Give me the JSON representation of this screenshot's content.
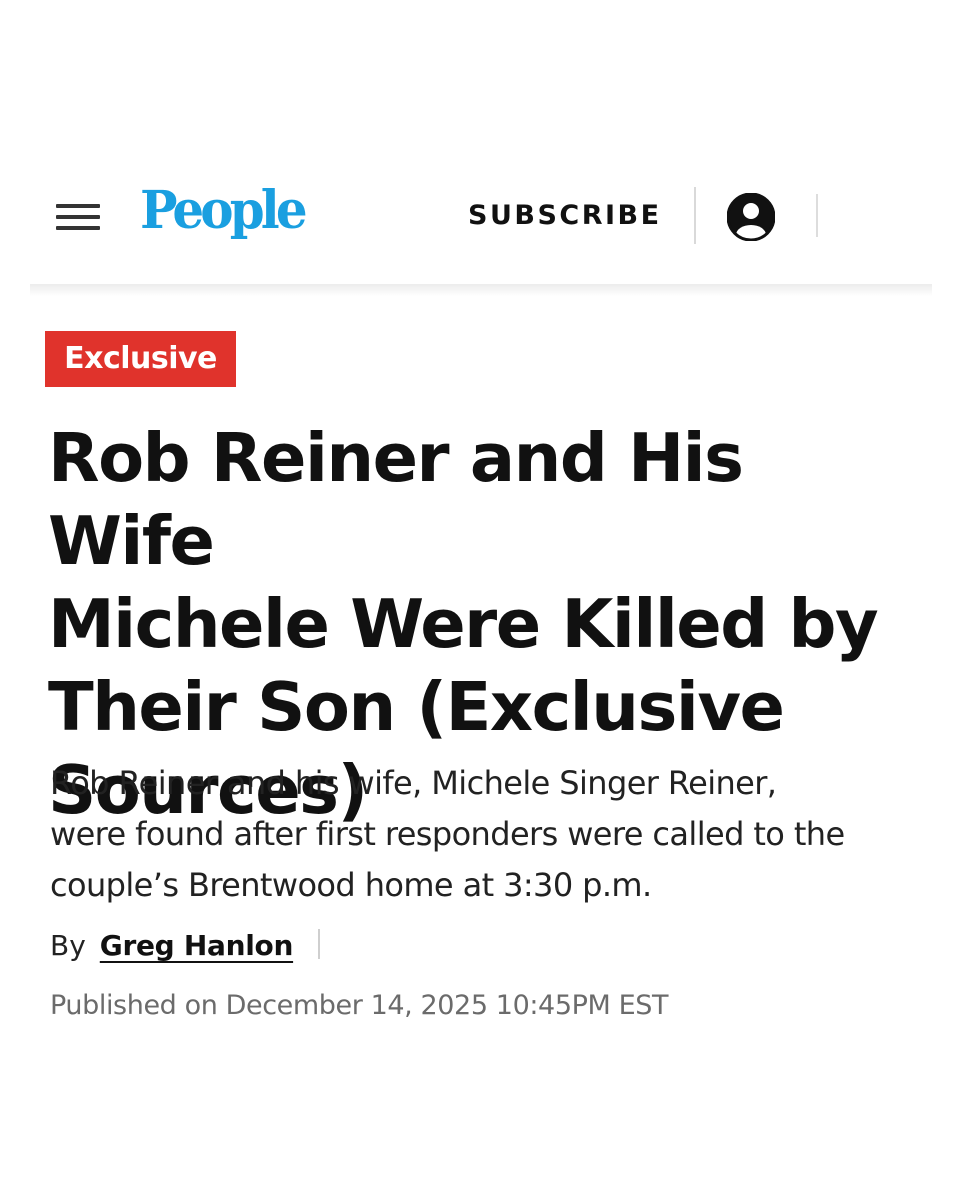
{
  "header": {
    "logo_text": "People",
    "subscribe_label": "SUBSCRIBE",
    "menu_icon": "hamburger-menu-icon",
    "account_icon": "user-account-icon",
    "brand_color": "#1a9fe0"
  },
  "article": {
    "badge_label": "Exclusive",
    "badge_color": "#e0332c",
    "headline_lines": [
      "Rob Reiner and His Wife",
      "Michele Were Killed by",
      "Their Son (Exclusive",
      "Sources)"
    ],
    "dek_lines": [
      "Rob Reiner and his wife, Michele Singer Reiner,",
      "were found after first responders were called to the",
      "couple’s Brentwood home at 3:30 p.m."
    ],
    "byline_prefix": "By",
    "author": "Greg Hanlon",
    "published": "Published on December 14, 2025 10:45PM EST"
  }
}
